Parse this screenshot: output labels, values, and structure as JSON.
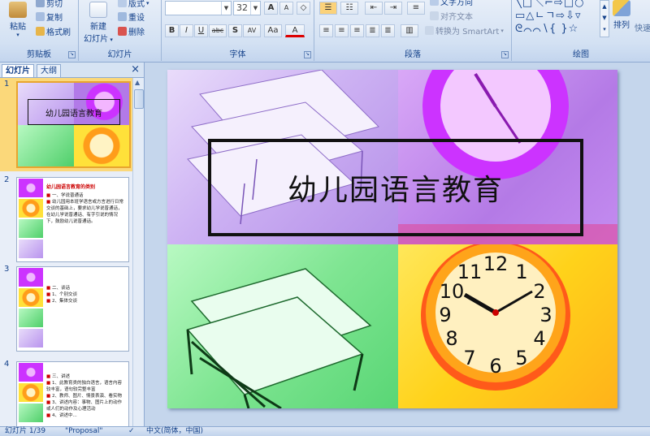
{
  "ribbon": {
    "clipboard": {
      "paste": "粘贴",
      "cut": "剪切",
      "copy": "复制",
      "format_painter": "格式刷",
      "label": "剪贴板"
    },
    "slides": {
      "new_slide": "新建",
      "new_slide_line2": "幻灯片",
      "layout": "版式",
      "reset": "重设",
      "delete": "删除",
      "label": "幻灯片"
    },
    "font": {
      "size": "32",
      "label": "字体",
      "bold": "B",
      "italic": "I",
      "underline": "U",
      "strike": "abc",
      "shadow": "S",
      "spacing": "AV",
      "case": "Aa",
      "color": "A",
      "grow": "A",
      "shrink": "A"
    },
    "paragraph": {
      "text_direction": "文字方向",
      "align_text": "对齐文本",
      "smartart": "转换为 SmartArt",
      "label": "段落"
    },
    "drawing": {
      "arrange": "排列",
      "quick_styles": "快速",
      "label": "绘图"
    }
  },
  "leftpane": {
    "tab_slides": "幻灯片",
    "tab_outline": "大纲",
    "close": "×",
    "thumbs": [
      {
        "num": "1",
        "title": "幼儿园语言教育"
      },
      {
        "num": "2",
        "title": "幼儿园语言教育的类别",
        "lines": [
          "一、学说普通话",
          "幼儿园用本班学语言或方言进行日常交谈的基础上，要求幼儿学说普通话，在幼儿学说普通话、有字引说的情况下，鼓励幼儿说普通话。"
        ]
      },
      {
        "num": "3",
        "lines": [
          "二、谈话",
          "1、个别交谈",
          "2、集体交谈"
        ]
      },
      {
        "num": "4",
        "lines": [
          "三、讲述",
          "1、此教育类的独白语言，语言内容较丰富，语句较完整丰富",
          "2、教师、图片、情景表演、看实物",
          "3、讲述内容：事物、图片上的动作或人们的动作及心理活动",
          "4、讲述中..."
        ]
      }
    ]
  },
  "slide": {
    "title": "幼儿园语言教育"
  },
  "status": {
    "slide_info": "幻灯片 1/39",
    "theme": "\"Proposal\"",
    "language": "中文(简体，中国)"
  },
  "colors": {
    "purple": "#c89bf0",
    "magenta": "#cc33ff",
    "green": "#8ff5a0",
    "orange": "#ffb23a",
    "yellow": "#ffe13a",
    "selected": "#fbd87a"
  }
}
